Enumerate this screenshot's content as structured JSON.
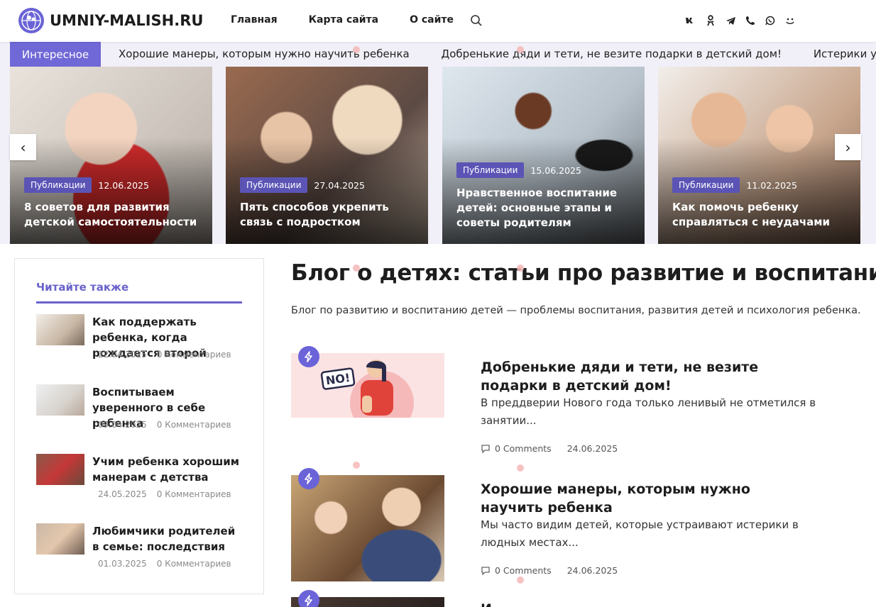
{
  "header": {
    "logo_text": "UMNIY-MALISH.RU",
    "nav": [
      "Главная",
      "Карта сайта",
      "О сайте"
    ],
    "socials": [
      "vk",
      "ok",
      "tg",
      "viber",
      "whatsapp",
      "max"
    ]
  },
  "ticker": {
    "label": "Интересное",
    "items": [
      "Хорошие манеры, которым нужно научить ребенка",
      "Добренькие дяди и тети, не везите подарки в детский дом!",
      "Истерики у грудничка"
    ]
  },
  "slider": {
    "prev": "‹",
    "next": "›",
    "cards": [
      {
        "badge": "Публикации",
        "date": "12.06.2025",
        "title": "8 советов для развития детской самостоятельности",
        "image": "baby-in-red-photo"
      },
      {
        "badge": "Публикации",
        "date": "27.04.2025",
        "title": "Пять способов укрепить связь с подростком",
        "image": "mother-daughter-photo"
      },
      {
        "badge": "Публикации",
        "date": "15.06.2025",
        "title": "Нравственное воспитание детей: основные этапы и советы родителям",
        "image": "woman-lamp-photo"
      },
      {
        "badge": "Публикации",
        "date": "11.02.2025",
        "title": "Как помочь ребенку справляться с неудачами",
        "image": "mother-teen-photo"
      }
    ]
  },
  "sidebar": {
    "title": "Читайте также",
    "items": [
      {
        "title": "Как поддержать ребенка, когда рождается второй",
        "date": "22.04.2025",
        "comments": "0 Комментариев"
      },
      {
        "title": "Воспитываем уверенного в себе ребенка",
        "date": "09.04.2025",
        "comments": "0 Комментариев"
      },
      {
        "title": "Учим ребенка хорошим манерам с детства",
        "date": "24.05.2025",
        "comments": "0 Комментариев"
      },
      {
        "title": "Любимчики родителей в семье: последствия",
        "date": "01.03.2025",
        "comments": "0 Комментариев"
      }
    ]
  },
  "main": {
    "title": "Блог о детях: статьи про развитие и воспитание",
    "description": "Блог по развитию и воспитанию детей — проблемы воспитания, развития детей и психология ребенка.",
    "posts": [
      {
        "title": "Добренькие дяди и тети, не везите подарки в детский дом!",
        "excerpt": "В преддверии Нового года только ленивый не отметился в занятии...",
        "comments": "0 Comments",
        "date": "24.06.2025",
        "thumb_text": "NO!"
      },
      {
        "title": "Хорошие манеры, которым нужно научить ребенка",
        "excerpt": "Мы часто видим детей, которые устраивают истерики в людных местах...",
        "comments": "0 Comments",
        "date": "24.06.2025"
      },
      {
        "title": "И",
        "excerpt": "",
        "comments": "",
        "date": ""
      }
    ]
  },
  "colors": {
    "accent": "#6a63d6",
    "badge": "#5b54b5",
    "ticker_bg": "#f1f0f8"
  }
}
